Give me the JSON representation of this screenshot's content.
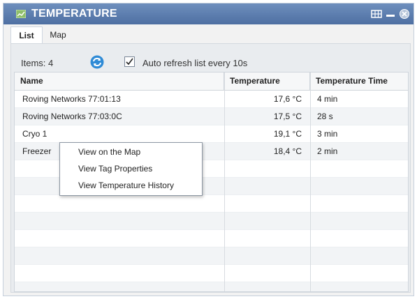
{
  "window": {
    "title": "TEMPERATURE",
    "icons": {
      "title": "chart-icon",
      "grid": "grid-icon",
      "minimize": "minimize-icon",
      "close": "close-icon"
    }
  },
  "tabs": [
    {
      "label": "List",
      "active": true
    },
    {
      "label": "Map",
      "active": false
    }
  ],
  "toolbar": {
    "items_count_label": "Items: 4",
    "refresh_icon": "refresh-icon",
    "auto_refresh_label": "Auto refresh list every 10s",
    "auto_refresh_checked": true
  },
  "table": {
    "headers": [
      "Name",
      "Temperature",
      "Temperature Time"
    ],
    "rows": [
      {
        "name": "Roving Networks 77:01:13",
        "temperature": "17,6 °C",
        "time": "4 min"
      },
      {
        "name": "Roving Networks 77:03:0C",
        "temperature": "17,5 °C",
        "time": "28 s"
      },
      {
        "name": "Cryo 1",
        "temperature": "19,1 °C",
        "time": "3 min"
      },
      {
        "name": "Freezer",
        "temperature": "18,4 °C",
        "time": "2 min"
      }
    ]
  },
  "context_menu": {
    "items": [
      "View on the Map",
      "View Tag Properties",
      "View Temperature History"
    ]
  },
  "colors": {
    "titlebar": "#5b7cb0",
    "accent": "#2f8bd6"
  }
}
